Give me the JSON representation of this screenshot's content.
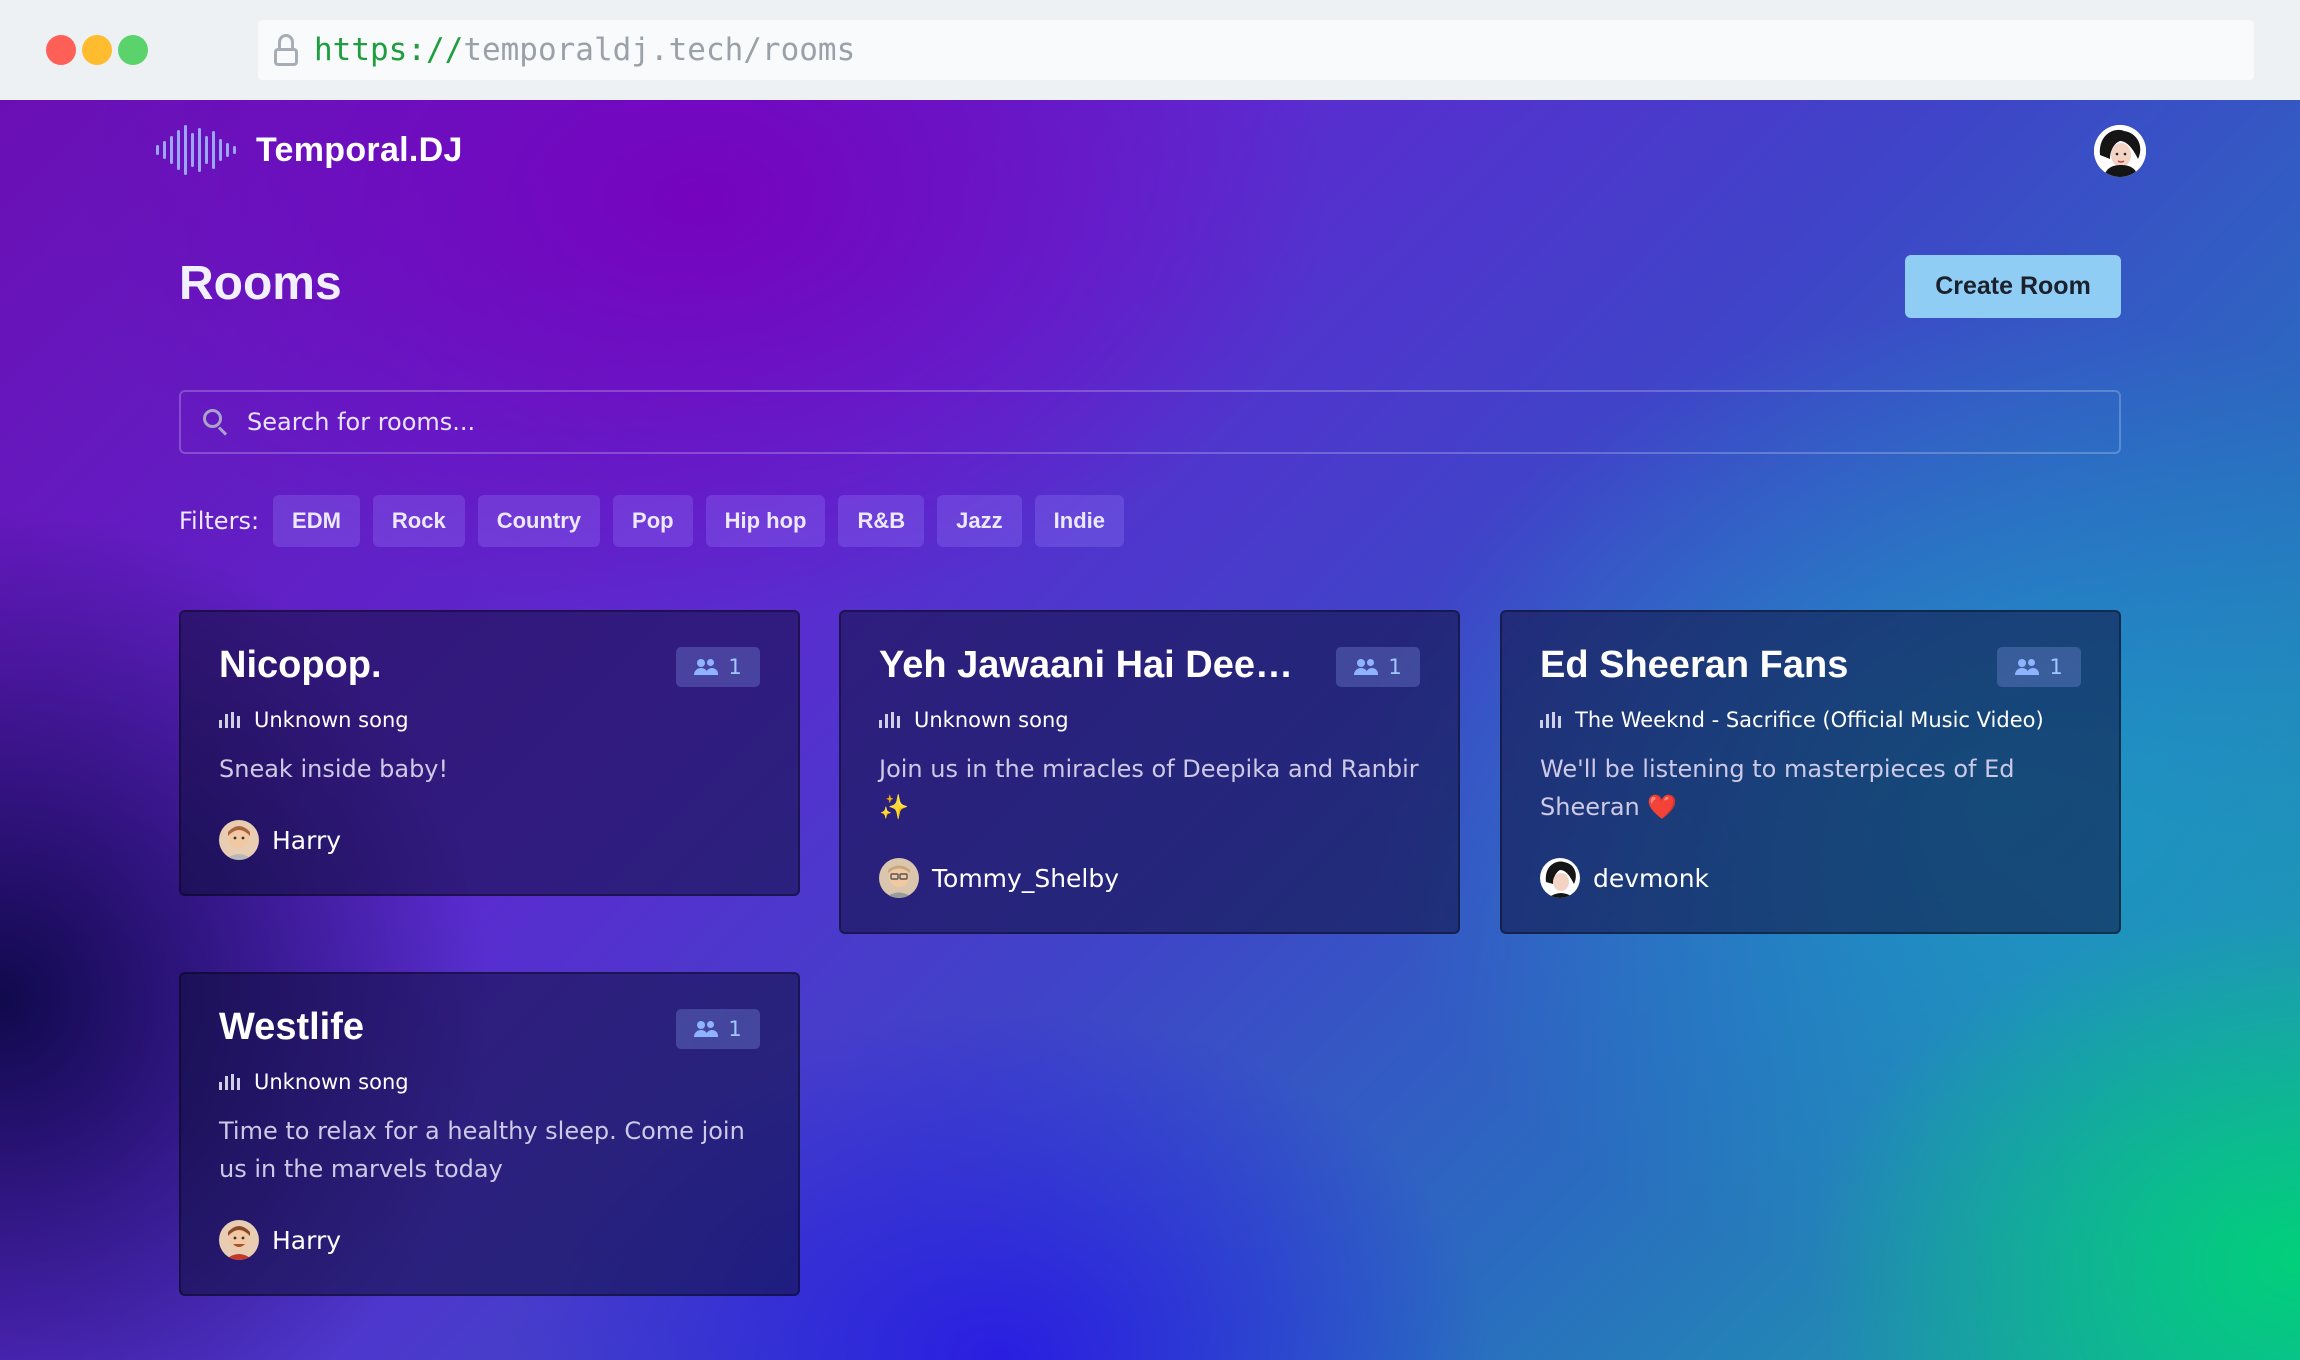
{
  "browser": {
    "url_protocol": "https://",
    "url_rest": "temporaldj.tech/rooms"
  },
  "header": {
    "brand": "Temporal.DJ",
    "logo_icon": "sound-wave-icon",
    "avatar_icon": "user-avatar"
  },
  "page": {
    "title": "Rooms",
    "create_button": "Create Room"
  },
  "search": {
    "placeholder": "Search for rooms..."
  },
  "filters": {
    "label": "Filters:",
    "items": [
      "EDM",
      "Rock",
      "Country",
      "Pop",
      "Hip hop",
      "R&B",
      "Jazz",
      "Indie"
    ]
  },
  "rooms": [
    {
      "name": "Nicopop.",
      "listeners": "1",
      "song": "Unknown song",
      "description": "Sneak inside baby!",
      "owner": "Harry"
    },
    {
      "name": "Yeh Jawaani Hai Deewani",
      "listeners": "1",
      "song": "Unknown song",
      "description": "Join us in the miracles of Deepika and Ranbir ✨",
      "owner": "Tommy_Shelby"
    },
    {
      "name": "Ed Sheeran Fans",
      "listeners": "1",
      "song": "The Weeknd - Sacrifice (Official Music Video)",
      "description": "We'll be listening to masterpieces of Ed Sheeran ❤️",
      "owner": "devmonk"
    },
    {
      "name": "Westlife",
      "listeners": "1",
      "song": "Unknown song",
      "description": "Time to relax for a healthy sleep. Come join us in the marvels today",
      "owner": "Harry"
    }
  ],
  "colors": {
    "accent_button": "#90cdf4",
    "badge_text": "#9fc8ff",
    "url_protocol": "#1e9e3f"
  }
}
